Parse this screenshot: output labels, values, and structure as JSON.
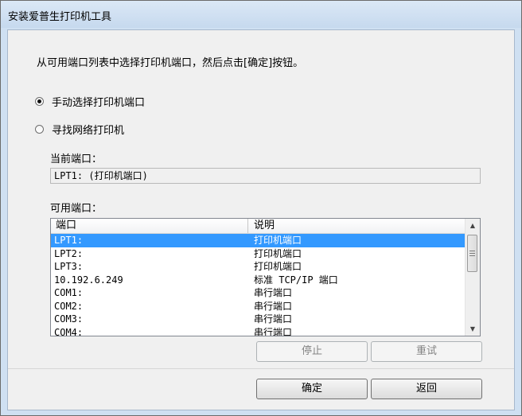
{
  "window": {
    "title": "安装爱普生打印机工具"
  },
  "instruction": "从可用端口列表中选择打印机端口，然后点击[确定]按钮。",
  "options": {
    "manual": {
      "label": "手动选择打印机端口",
      "checked": true
    },
    "network": {
      "label": "寻找网络打印机",
      "checked": false
    }
  },
  "current_port": {
    "label": "当前端口：",
    "value": "LPT1: (打印机端口)"
  },
  "available_ports": {
    "label": "可用端口：",
    "columns": {
      "port": "端口",
      "desc": "说明"
    },
    "rows": [
      {
        "port": "LPT1:",
        "desc": "打印机端口",
        "selected": true
      },
      {
        "port": "LPT2:",
        "desc": "打印机端口",
        "selected": false
      },
      {
        "port": "LPT3:",
        "desc": "打印机端口",
        "selected": false
      },
      {
        "port": "10.192.6.249",
        "desc": "标准 TCP/IP 端口",
        "selected": false
      },
      {
        "port": "COM1:",
        "desc": "串行端口",
        "selected": false
      },
      {
        "port": "COM2:",
        "desc": "串行端口",
        "selected": false
      },
      {
        "port": "COM3:",
        "desc": "串行端口",
        "selected": false
      },
      {
        "port": "COM4:",
        "desc": "串行端口",
        "selected": false
      }
    ]
  },
  "buttons": {
    "stop": "停止",
    "retry": "重试",
    "ok": "确定",
    "back": "返回"
  },
  "colors": {
    "selection": "#3399ff",
    "title_bar": "#cfe0f2",
    "dialog_bg": "#f0f0f0"
  }
}
